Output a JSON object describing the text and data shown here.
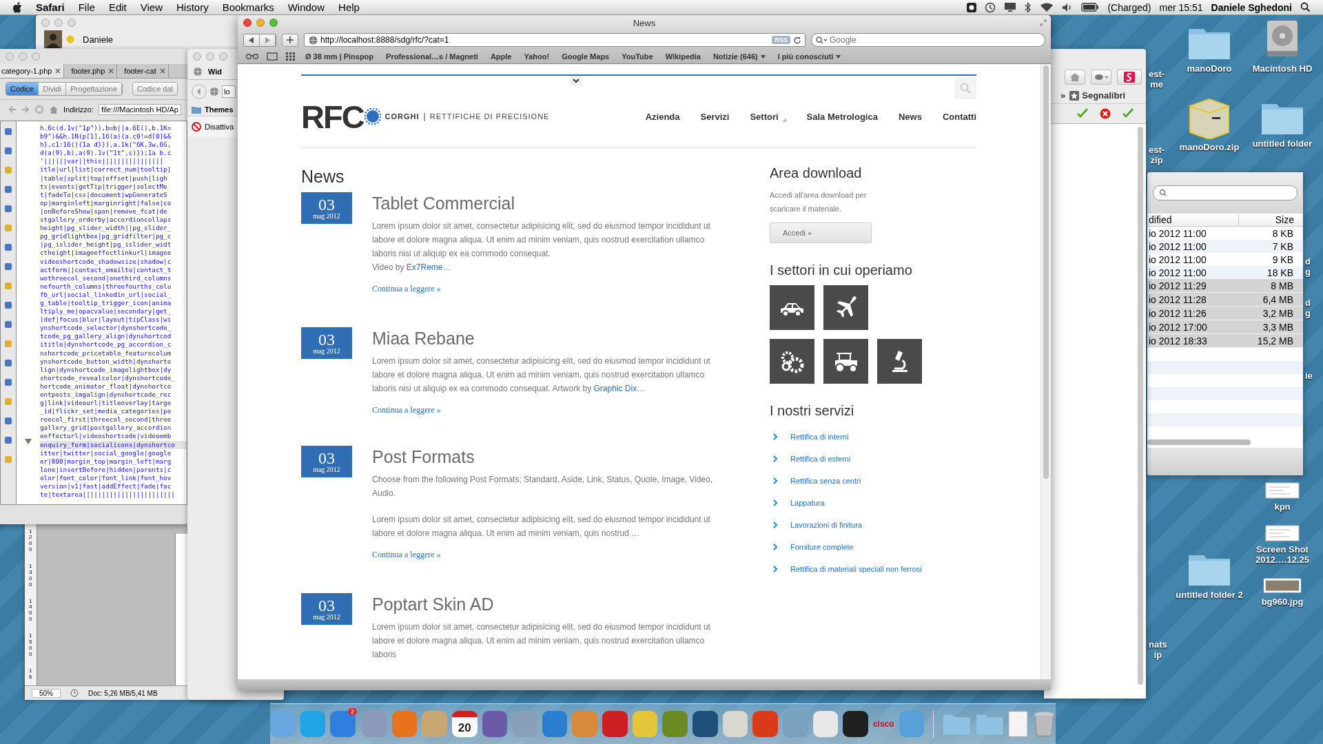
{
  "menubar": {
    "app": "Safari",
    "menus": [
      "File",
      "Edit",
      "View",
      "History",
      "Bookmarks",
      "Window",
      "Help"
    ],
    "battery": "(Charged)",
    "clock": "mer 15:51",
    "user": "Daniele Sghedoni"
  },
  "chat_window": {
    "name": "Daniele"
  },
  "editor": {
    "tabs": [
      {
        "label": "category-1.php",
        "selected": true
      },
      {
        "label": "footer.php",
        "selected": false
      },
      {
        "label": "footer-cat",
        "selected": false
      }
    ],
    "views": [
      {
        "label": "Codice",
        "selected": true
      },
      {
        "label": "Dividi",
        "selected": false
      },
      {
        "label": "Progettazione",
        "selected": false
      }
    ],
    "live_button": "Codice dal",
    "address_label": "Indirizzo:",
    "address": "file:///Macintosh HD/Ap",
    "code_lines": [
      {
        "text": "h.6c(d.1v(\"1p\")),b=b||a.6E(),b.1K=",
        "selected": false
      },
      {
        "text": "b9\")&&h.1N(p[1],16(a){a.c0!=d[0]&&",
        "selected": false
      },
      {
        "text": "h},c1:16(){1a d}}),a.1k(\"6K,3w,6G,",
        "selected": false
      },
      {
        "text": "d(a(9),b),a(9).1v(\"1t\",c)});1a b.c",
        "selected": false
      },
      {
        "text": "'||||||var||this||||||||||||||||",
        "selected": false
      },
      {
        "text": "itle|url|list|correct_num|tooltip|",
        "selected": false
      },
      {
        "text": "|table|split|top|offset|push|ligh",
        "selected": false
      },
      {
        "text": "ts|events|getTip|trigger|selectMe",
        "selected": false
      },
      {
        "text": "t|fadeTo|css|document|wpGenerateS",
        "selected": false
      },
      {
        "text": "op|marginleft|marginright|false|co",
        "selected": false
      },
      {
        "text": "|onBeforeShow|span|remove_fcat|de",
        "selected": false
      },
      {
        "text": "stgallery_orderby|accordioncollaps",
        "selected": false
      },
      {
        "text": "height|pg_slider_width||pg_slider_",
        "selected": false
      },
      {
        "text": "pg_gridlightbox|pg_gridfilter|pg_c",
        "selected": false
      },
      {
        "text": "|pg_islider_height|pg_islider_widt",
        "selected": false
      },
      {
        "text": "ctheight|imageeffectlinkurl|imagee",
        "selected": false
      },
      {
        "text": "videoshortcode_shadowsize|shadow|c",
        "selected": false
      },
      {
        "text": "actform||contact_emailto|contact_t",
        "selected": false
      },
      {
        "text": "wothreecol_second|onethird_columns",
        "selected": false
      },
      {
        "text": "nefourth_columns|threefourths_colu",
        "selected": false
      },
      {
        "text": "fb_url|social_linkedin_url|social_",
        "selected": false
      },
      {
        "text": "g_table|tooltip_trigger_icon|anima",
        "selected": false
      },
      {
        "text": "ltiply_me|opacvalue|secondary|get_",
        "selected": false
      },
      {
        "text": "|def|focus|blur|layout|tipClass|wi",
        "selected": false
      },
      {
        "text": "ynshortcode_selector|dynshortcode_",
        "selected": false
      },
      {
        "text": "tcode_pg_gallery_align|dynshortcod",
        "selected": false
      },
      {
        "text": "ititle|dynshortcode_pg_accordion_c",
        "selected": false
      },
      {
        "text": "nshortcode_pricetable_featurecolum",
        "selected": false
      },
      {
        "text": "ynshortcode_button_width|dynshorto",
        "selected": false
      },
      {
        "text": "lign|dynshortcode_imagelightbox|dy",
        "selected": false
      },
      {
        "text": "shortcode_revealcolor|dynshortcode_",
        "selected": false
      },
      {
        "text": "hortcode_animator_float|dynshortco",
        "selected": false
      },
      {
        "text": "entposts_imgalign|dynshortcode_rec",
        "selected": false
      },
      {
        "text": "g|link|videourl|titleoverlay|targe",
        "selected": false
      },
      {
        "text": "_id|flickr_set|media_categories|po",
        "selected": false
      },
      {
        "text": "reecol_first|threecol_second|three",
        "selected": false
      },
      {
        "text": "gallery_grid|postgallery_accordion",
        "selected": false
      },
      {
        "text": "eeffecturl|videoshortcode|videoemb",
        "selected": false
      },
      {
        "text": "enquiry_form|socialicons|dynshortco",
        "selected": true
      },
      {
        "text": "itter|twitter|social_google|google",
        "selected": false
      },
      {
        "text": "er|800|margin_top|margin_left|marg",
        "selected": false
      },
      {
        "text": "lone|insertBefore|hidden|parents|c",
        "selected": false
      },
      {
        "text": "olor|font_color|font_link|font_hov",
        "selected": false
      },
      {
        "text": "version|v1|fast|addEffect|fade|fac",
        "selected": false
      },
      {
        "text": "te|textarea||||||||||||||||||||||||",
        "selected": false
      }
    ],
    "ruler_marks": [
      "1200",
      "1300",
      "1400",
      "1500",
      "16"
    ],
    "zoom": "50%",
    "doc_size": "Doc: 5,26 MB/5,41 MB"
  },
  "mid_window": {
    "tab": "Wid",
    "address": "lo",
    "bookmark": "Themes",
    "notice": "Disattiva"
  },
  "safari": {
    "title": "News",
    "url": "http://localhost:8888/sdg/rfc/?cat=1",
    "rss": "RSS",
    "search_placeholder": "Google",
    "bookmarks": [
      {
        "label": "Ø 38 mm | Pinspop",
        "menu": false
      },
      {
        "label": "Professional…s / Magneti",
        "menu": false
      },
      {
        "label": "Apple",
        "menu": false
      },
      {
        "label": "Yahoo!",
        "menu": false
      },
      {
        "label": "Google Maps",
        "menu": false
      },
      {
        "label": "YouTube",
        "menu": false
      },
      {
        "label": "Wikipedia",
        "menu": false
      },
      {
        "label": "Notizie (646)",
        "menu": true
      },
      {
        "label": "I più conosciuti",
        "menu": true
      }
    ]
  },
  "site": {
    "logo": "RFC",
    "brand": "CORGHI",
    "separator": "|",
    "tagline": "RETTIFICHE DI PRECISIONE",
    "nav": [
      {
        "label": "Azienda",
        "submenu": false
      },
      {
        "label": "Servizi",
        "submenu": false
      },
      {
        "label": "Settori",
        "submenu": true
      },
      {
        "label": "Sala Metrologica",
        "submenu": false
      },
      {
        "label": "News",
        "submenu": false
      },
      {
        "label": "Contatti",
        "submenu": false
      }
    ],
    "page_title": "News",
    "posts": [
      {
        "day": "03",
        "month": "mag 2012",
        "title": "Tablet Commercial",
        "more": "Continua a leggere »",
        "paragraphs": [
          {
            "kind": "text",
            "text": "Lorem ipsum dolor sit amet, consectetur adipisicing elit, sed do eiusmod tempor incididunt ut labore et dolore magna aliqua. Ut enim ad minim veniam, quis nostrud exercitation ullamco laboris nisi ut aliquip ex ea commodo consequat."
          },
          {
            "kind": "credit",
            "text": "Video by ",
            "link": "Ex7Reme",
            "after": "…"
          }
        ]
      },
      {
        "day": "03",
        "month": "mag 2012",
        "title": "Miaa Rebane",
        "more": "Continua a leggere »",
        "paragraphs": [
          {
            "kind": "text",
            "text": "Lorem ipsum dolor sit amet, consectetur adipisicing elit, sed do eiusmod tempor incididunt ut labore et dolore magna aliqua. Ut enim ad minim veniam, quis nostrud exercitation ullamco laboris nisi ut aliquip ex ea commodo consequat. Artwork by ",
            "link": "Graphic Dix",
            "after": "…"
          }
        ]
      },
      {
        "day": "03",
        "month": "mag 2012",
        "title": "Post Formats",
        "more": "Continua a leggere »",
        "paragraphs": [
          {
            "kind": "text",
            "text": "Choose from the following Post Formats; Standard, Aside, Link, Status, Quote, Image, Video, Audio."
          },
          {
            "kind": "text",
            "text": "Lorem ipsum dolor sit amet, consectetur adipisicing elit, sed do eiusmod tempor incididunt ut labore et dolore magna aliqua. Ut enim ad minim veniam, quis nostrud …"
          }
        ]
      },
      {
        "day": "03",
        "month": "mag 2012",
        "title": "Poptart Skin AD",
        "paragraphs": [
          {
            "kind": "text",
            "text": "Lorem ipsum dolor sit amet, consectetur adipisicing elit, sed do eiusmod tempor incididunt ut labore et dolore magna aliqua. Ut enim ad minim veniam, quis nostrud exercitation ullamco laboris"
          }
        ]
      }
    ],
    "download": {
      "title": "Area download",
      "text": "Accedi all'area download per scaricare il materiale.",
      "button": "Accedi »"
    },
    "sectors_title": "I settori in cui operiamo",
    "services_title": "I nostri servizi",
    "services": [
      "Rettifica di interni",
      "Rettifica di esterni",
      "Rettifica senza centri",
      "Lappatura",
      "Lavorazioni di finitura",
      "Forniture complete",
      "Rettifica di materiali speciali non ferrosi"
    ]
  },
  "right_window": {
    "chevron": "»",
    "bookmarks": "Segnalibri"
  },
  "finder": {
    "columns": [
      "dified",
      "Size"
    ],
    "rows": [
      {
        "date": "io 2012 11:00",
        "size": "8 KB",
        "selected": false
      },
      {
        "date": "io 2012 11:00",
        "size": "7 KB",
        "selected": false
      },
      {
        "date": "io 2012 11:00",
        "size": "9 KB",
        "selected": false
      },
      {
        "date": "io 2012 11:00",
        "size": "18 KB",
        "selected": false
      },
      {
        "date": "io 2012 11:29",
        "size": "8 MB",
        "selected": true
      },
      {
        "date": "io 2012 11:28",
        "size": "6,4 MB",
        "selected": true
      },
      {
        "date": "io 2012 11:26",
        "size": "3,2 MB",
        "selected": true
      },
      {
        "date": "io 2012 17:00",
        "size": "3,3 MB",
        "selected": true
      },
      {
        "date": "io 2012 18:33",
        "size": "15,2 MB",
        "selected": true
      }
    ]
  },
  "desktop_icons": [
    {
      "kind": "folder",
      "label": "manoDoro"
    },
    {
      "kind": "disk",
      "label": "Macintosh HD"
    },
    {
      "kind": "zip",
      "label": "manoDoro.zip"
    },
    {
      "kind": "folder",
      "label": "untitled folder"
    },
    {
      "kind": "doc",
      "label": "kpn"
    },
    {
      "kind": "doc",
      "label": "Screen Shot 2012….12.25"
    },
    {
      "kind": "folder",
      "label": "untitled folder 2"
    },
    {
      "kind": "image",
      "label": "bg960.jpg"
    }
  ],
  "label_fragments": [
    [
      "est-",
      "me"
    ],
    [
      "est-",
      "zip"
    ],
    [
      "d",
      "g"
    ],
    [
      "d",
      "g"
    ],
    [
      "ie"
    ],
    [
      "nats",
      "ip"
    ]
  ],
  "dock": {
    "badge": "2",
    "calendar_day": "20",
    "cisco": "cisco"
  }
}
